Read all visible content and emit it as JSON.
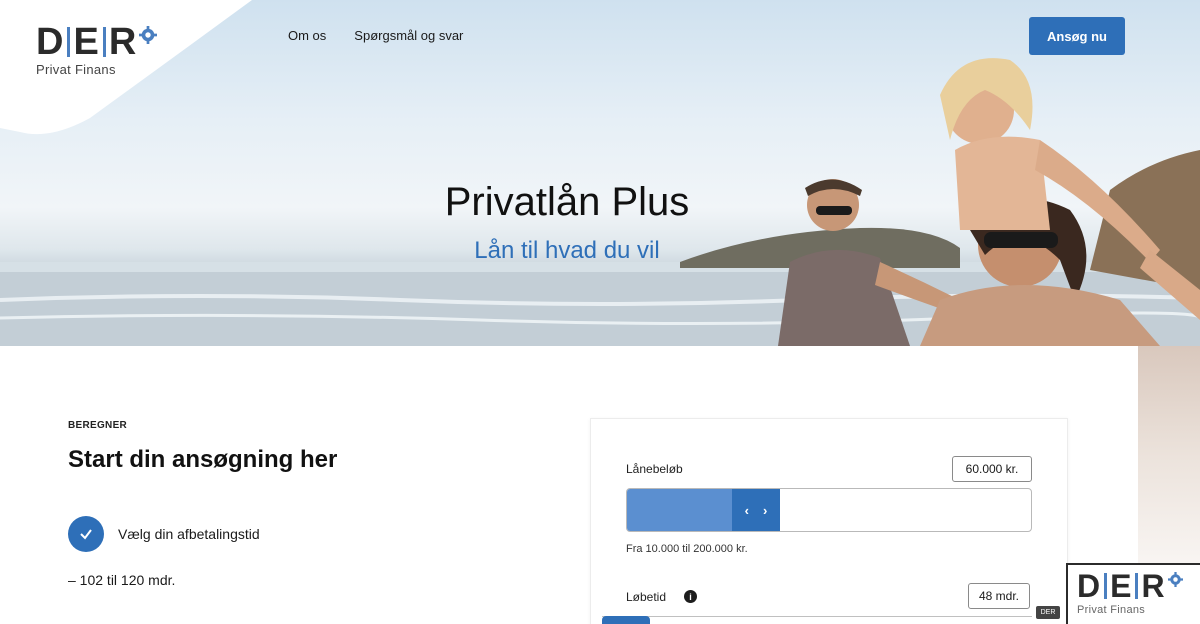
{
  "brand": {
    "letters": [
      "D",
      "E",
      "R"
    ],
    "tagline": "Privat Finans",
    "accent_color": "#2e6fb8",
    "gear_icon": "gear-icon"
  },
  "nav": {
    "items": [
      {
        "label": "Om os"
      },
      {
        "label": "Spørgsmål og svar"
      }
    ],
    "apply_label": "Ansøg nu"
  },
  "hero": {
    "title": "Privatlån Plus",
    "subtitle": "Lån til hvad du vil"
  },
  "calculator_intro": {
    "eyebrow": "BEREGNER",
    "title": "Start din ansøgning her",
    "step_label": "Vælg din afbetalingstid",
    "step_range": "– 102 til 120 mdr."
  },
  "calculator": {
    "loan_amount_label": "Lånebeløb",
    "loan_amount_value": "60.000 kr.",
    "loan_amount_fraction": 0.26,
    "loan_range_hint": "Fra 10.000 til 200.000 kr.",
    "term_label": "Løbetid",
    "term_value": "48 mdr.",
    "handle_left_icon": "chevron-left-icon",
    "handle_right_icon": "chevron-right-icon"
  },
  "corner_widget": {
    "letters": [
      "D",
      "E",
      "R"
    ],
    "tagline": "Privat Finans",
    "tag": "DER"
  }
}
